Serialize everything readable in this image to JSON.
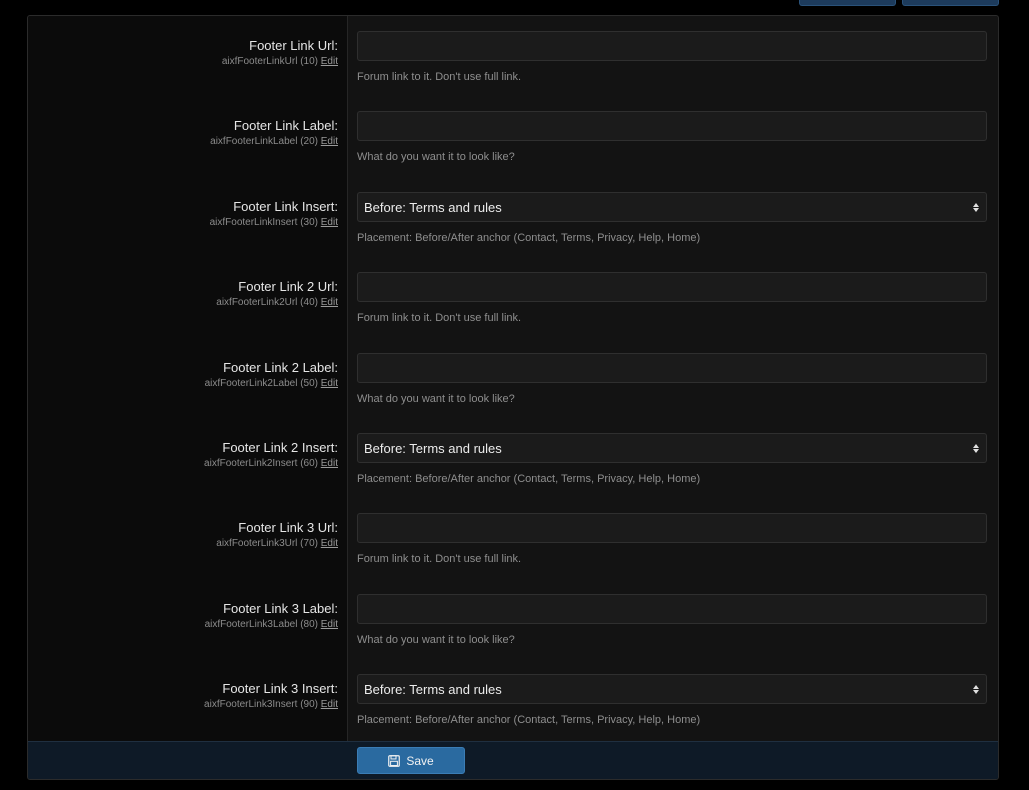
{
  "rows": [
    {
      "label": "Footer Link Url:",
      "var": "aixfFooterLinkUrl (10)",
      "edit": "Edit",
      "type": "text",
      "value": "",
      "hint": "Forum link to it. Don't use full link."
    },
    {
      "label": "Footer Link Label:",
      "var": "aixfFooterLinkLabel (20)",
      "edit": "Edit",
      "type": "text",
      "value": "",
      "hint": "What do you want it to look like?"
    },
    {
      "label": "Footer Link Insert:",
      "var": "aixfFooterLinkInsert (30)",
      "edit": "Edit",
      "type": "select",
      "value": "Before: Terms and rules",
      "hint": "Placement: Before/After anchor (Contact, Terms, Privacy, Help, Home)"
    },
    {
      "label": "Footer Link 2 Url:",
      "var": "aixfFooterLink2Url (40)",
      "edit": "Edit",
      "type": "text",
      "value": "",
      "hint": "Forum link to it. Don't use full link."
    },
    {
      "label": "Footer Link 2 Label:",
      "var": "aixfFooterLink2Label (50)",
      "edit": "Edit",
      "type": "text",
      "value": "",
      "hint": "What do you want it to look like?"
    },
    {
      "label": "Footer Link 2 Insert:",
      "var": "aixfFooterLink2Insert (60)",
      "edit": "Edit",
      "type": "select",
      "value": "Before: Terms and rules",
      "hint": "Placement: Before/After anchor (Contact, Terms, Privacy, Help, Home)"
    },
    {
      "label": "Footer Link 3 Url:",
      "var": "aixfFooterLink3Url (70)",
      "edit": "Edit",
      "type": "text",
      "value": "",
      "hint": "Forum link to it. Don't use full link."
    },
    {
      "label": "Footer Link 3 Label:",
      "var": "aixfFooterLink3Label (80)",
      "edit": "Edit",
      "type": "text",
      "value": "",
      "hint": "What do you want it to look like?"
    },
    {
      "label": "Footer Link 3 Insert:",
      "var": "aixfFooterLink3Insert (90)",
      "edit": "Edit",
      "type": "select",
      "value": "Before: Terms and rules",
      "hint": "Placement: Before/After anchor (Contact, Terms, Privacy, Help, Home)"
    }
  ],
  "footer": {
    "save_label": "Save",
    "save_icon": "floppy-disk-icon"
  },
  "colors": {
    "accent": "#2a6aa0",
    "background": "#000000",
    "panel": "#131313"
  }
}
